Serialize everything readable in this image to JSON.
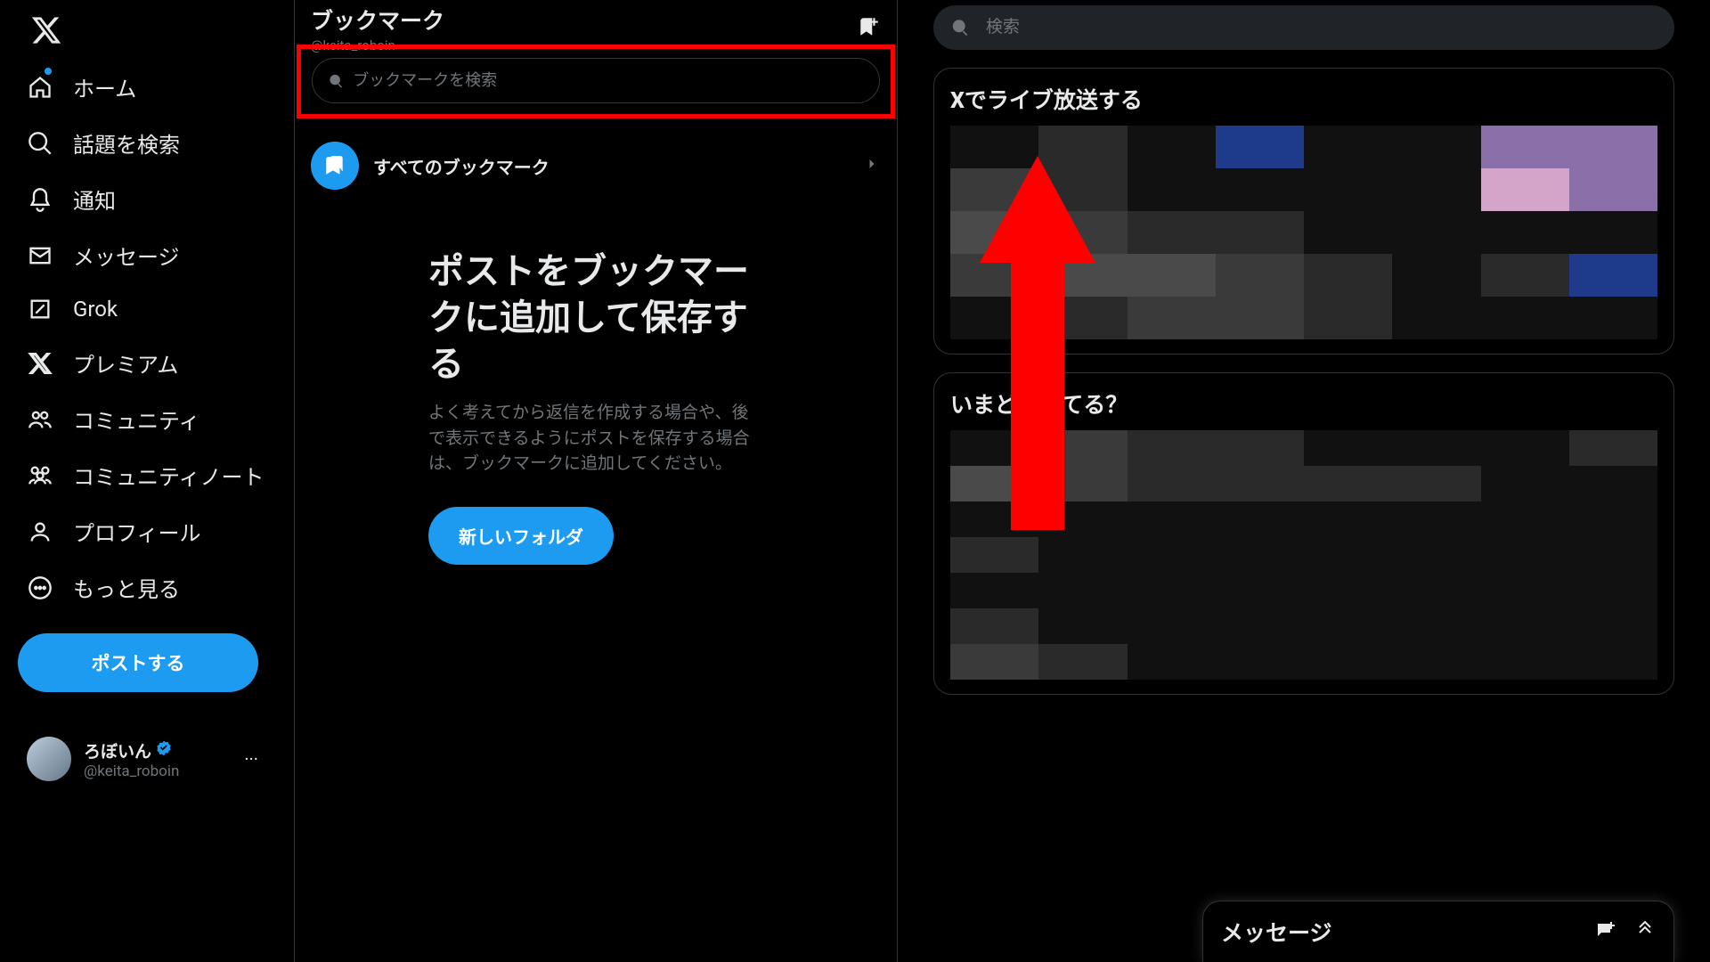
{
  "sidebar": {
    "items": [
      {
        "label": "ホーム"
      },
      {
        "label": "話題を検索"
      },
      {
        "label": "通知"
      },
      {
        "label": "メッセージ"
      },
      {
        "label": "Grok"
      },
      {
        "label": "プレミアム"
      },
      {
        "label": "コミュニティ"
      },
      {
        "label": "コミュニティノート"
      },
      {
        "label": "プロフィール"
      },
      {
        "label": "もっと見る"
      }
    ],
    "post_label": "ポストする",
    "account": {
      "name": "ろぼいん",
      "handle": "@keita_roboin"
    }
  },
  "main": {
    "title": "ブックマーク",
    "subtitle": "@keita_roboin",
    "search_placeholder": "ブックマークを検索",
    "all_bookmarks_label": "すべてのブックマーク",
    "empty_title": "ポストをブックマークに追加して保存する",
    "empty_body": "よく考えてから返信を作成する場合や、後で表示できるようにポストを保存する場合は、ブックマークに追加してください。",
    "folder_button": "新しいフォルダ"
  },
  "rail": {
    "search_placeholder": "検索",
    "live_title": "Xでライブ放送する",
    "whats_title": "いまどうしてる？"
  },
  "drawer": {
    "title": "メッセージ"
  },
  "colors": {
    "accent": "#1d9bf0",
    "annotation": "#ff0000"
  }
}
